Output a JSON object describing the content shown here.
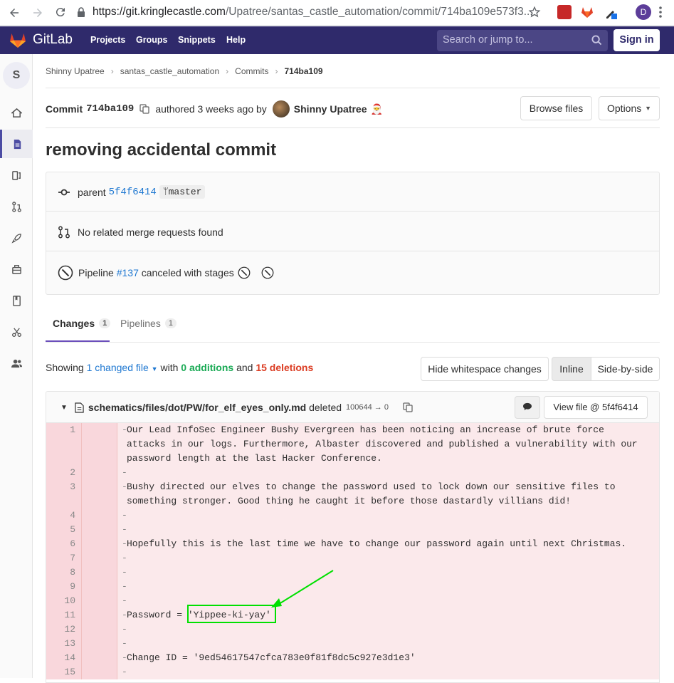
{
  "browser": {
    "url_domain": "https://git.kringlecastle.com",
    "url_path": "/Upatree/santas_castle_automation/commit/714ba109e573f3...",
    "profile_initial": "D"
  },
  "header": {
    "brand": "GitLab",
    "nav": [
      "Projects",
      "Groups",
      "Snippets",
      "Help"
    ],
    "search_placeholder": "Search or jump to...",
    "sign_in": "Sign in"
  },
  "sidebar": {
    "project_initial": "S"
  },
  "breadcrumb": [
    "Shinny Upatree",
    "santas_castle_automation",
    "Commits",
    "714ba109"
  ],
  "commit": {
    "label": "Commit",
    "sha": "714ba109",
    "authored": "authored 3 weeks ago by",
    "author": "Shinny Upatree",
    "browse_files": "Browse files",
    "options": "Options",
    "title": "removing accidental commit"
  },
  "info": {
    "parent_label": "parent",
    "parent_sha": "5f4f6414",
    "branch": "master",
    "merge_requests": "No related merge requests found",
    "pipeline_label": "Pipeline",
    "pipeline_id": "#137",
    "pipeline_status": "canceled with stages"
  },
  "tabs": [
    {
      "label": "Changes",
      "count": "1"
    },
    {
      "label": "Pipelines",
      "count": "1"
    }
  ],
  "summary": {
    "showing": "Showing",
    "changed": "1 changed file",
    "with": "with",
    "additions": "0 additions",
    "and": "and",
    "deletions": "15 deletions",
    "hide_whitespace": "Hide whitespace changes",
    "inline": "Inline",
    "side_by_side": "Side-by-side"
  },
  "file": {
    "path": "schematics/files/dot/PW/for_elf_eyes_only.md",
    "status": "deleted",
    "mode": "100644 → 0",
    "view_file": "View file @ 5f4f6414"
  },
  "diff_lines": [
    {
      "n": "1",
      "text": "Our Lead InfoSec Engineer Bushy Evergreen has been noticing an increase of brute force attacks in our logs. Furthermore, Albaster discovered and published a vulnerability with our password length at the last Hacker Conference."
    },
    {
      "n": "2",
      "text": ""
    },
    {
      "n": "3",
      "text": "Bushy directed our elves to change the password used to lock down our sensitive files to something stronger. Good thing he caught it before those dastardly villians did!"
    },
    {
      "n": "4",
      "text": ""
    },
    {
      "n": "5",
      "text": ""
    },
    {
      "n": "6",
      "text": "Hopefully this is the last time we have to change our password again until next Christmas."
    },
    {
      "n": "7",
      "text": ""
    },
    {
      "n": "8",
      "text": ""
    },
    {
      "n": "9",
      "text": ""
    },
    {
      "n": "10",
      "text": ""
    },
    {
      "n": "11",
      "text": "Password = 'Yippee-ki-yay'"
    },
    {
      "n": "12",
      "text": ""
    },
    {
      "n": "13",
      "text": ""
    },
    {
      "n": "14",
      "text": "Change ID = '9ed54617547cfca783e0f81f8dc5c927e3d1e3'"
    },
    {
      "n": "15",
      "text": ""
    }
  ],
  "colors": {
    "header_bg": "#2f2a6b",
    "diff_del_bg": "#fbe9eb",
    "annotation": "#00e000",
    "link": "#1f78d1"
  }
}
